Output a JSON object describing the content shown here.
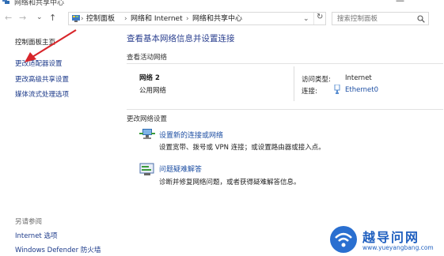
{
  "window": {
    "title": "网络和共享中心",
    "minimize": "—"
  },
  "nav": {
    "back": "←",
    "forward": "→",
    "recent": "⌄",
    "up": "↑"
  },
  "address": {
    "crumbs": [
      "控制面板",
      "网络和 Internet",
      "网络和共享中心"
    ],
    "separator": "›",
    "dropdown": "⌄",
    "refresh": "↻"
  },
  "search": {
    "placeholder": "搜索控制面板"
  },
  "sidebar": {
    "items": [
      "控制面板主页",
      "更改适配器设置",
      "更改高级共享设置",
      "媒体流式处理选项"
    ],
    "see_also_heading": "另请参阅",
    "see_also": [
      "Internet 选项",
      "Windows Defender 防火墙"
    ]
  },
  "main": {
    "title": "查看基本网络信息并设置连接",
    "active_heading": "查看活动网络",
    "network": {
      "name": "网络 2",
      "type": "公用网络",
      "access_label": "访问类型:",
      "access_value": "Internet",
      "conn_label": "连接:",
      "conn_value": "Ethernet0"
    },
    "change_heading": "更改网络设置",
    "tasks": [
      {
        "title": "设置新的连接或网络",
        "desc": "设置宽带、拨号或 VPN 连接；或设置路由器或接入点。"
      },
      {
        "title": "问题疑难解答",
        "desc": "诊断并修复网络问题，或者获得疑难解答信息。"
      }
    ]
  },
  "watermark": {
    "text": "越导问网",
    "url": "www.yueyangbang.com"
  },
  "colors": {
    "link": "#1e4fa3",
    "title": "#2a3f8f",
    "arrow": "#d8262b",
    "watermark": "#1f5fbf"
  }
}
